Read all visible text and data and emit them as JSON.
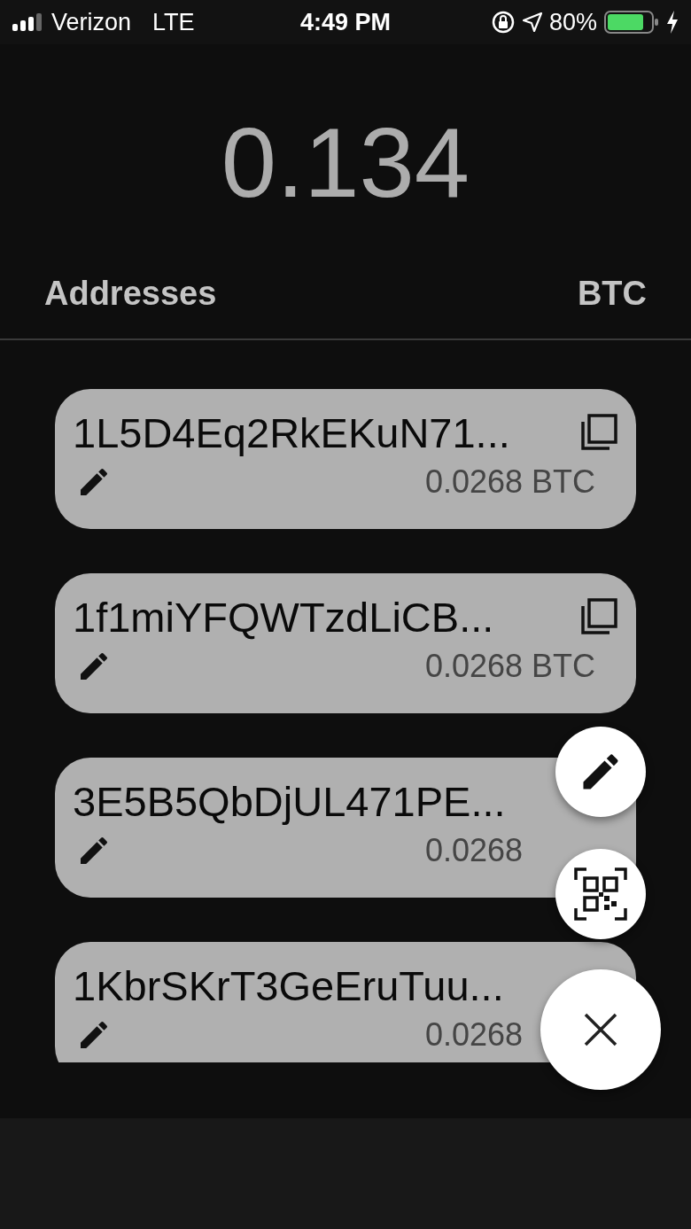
{
  "status_bar": {
    "carrier": "Verizon",
    "network": "LTE",
    "time": "4:49 PM",
    "battery_percent": "80%"
  },
  "balance": "0.134",
  "header": {
    "title": "Addresses",
    "unit": "BTC"
  },
  "addresses": [
    {
      "address": "1L5D4Eq2RkEKuN71...",
      "amount": "0.0268 BTC",
      "copy_icon": true
    },
    {
      "address": "1f1miYFQWTzdLiCB...",
      "amount": "0.0268 BTC",
      "copy_icon": true
    },
    {
      "address": "3E5B5QbDjUL471PE...",
      "amount": "0.0268",
      "copy_icon": false
    },
    {
      "address": "1KbrSKrT3GeEruTuu...",
      "amount": "0.0268",
      "copy_icon": false
    }
  ],
  "fab_menu": {
    "expanded": true
  }
}
